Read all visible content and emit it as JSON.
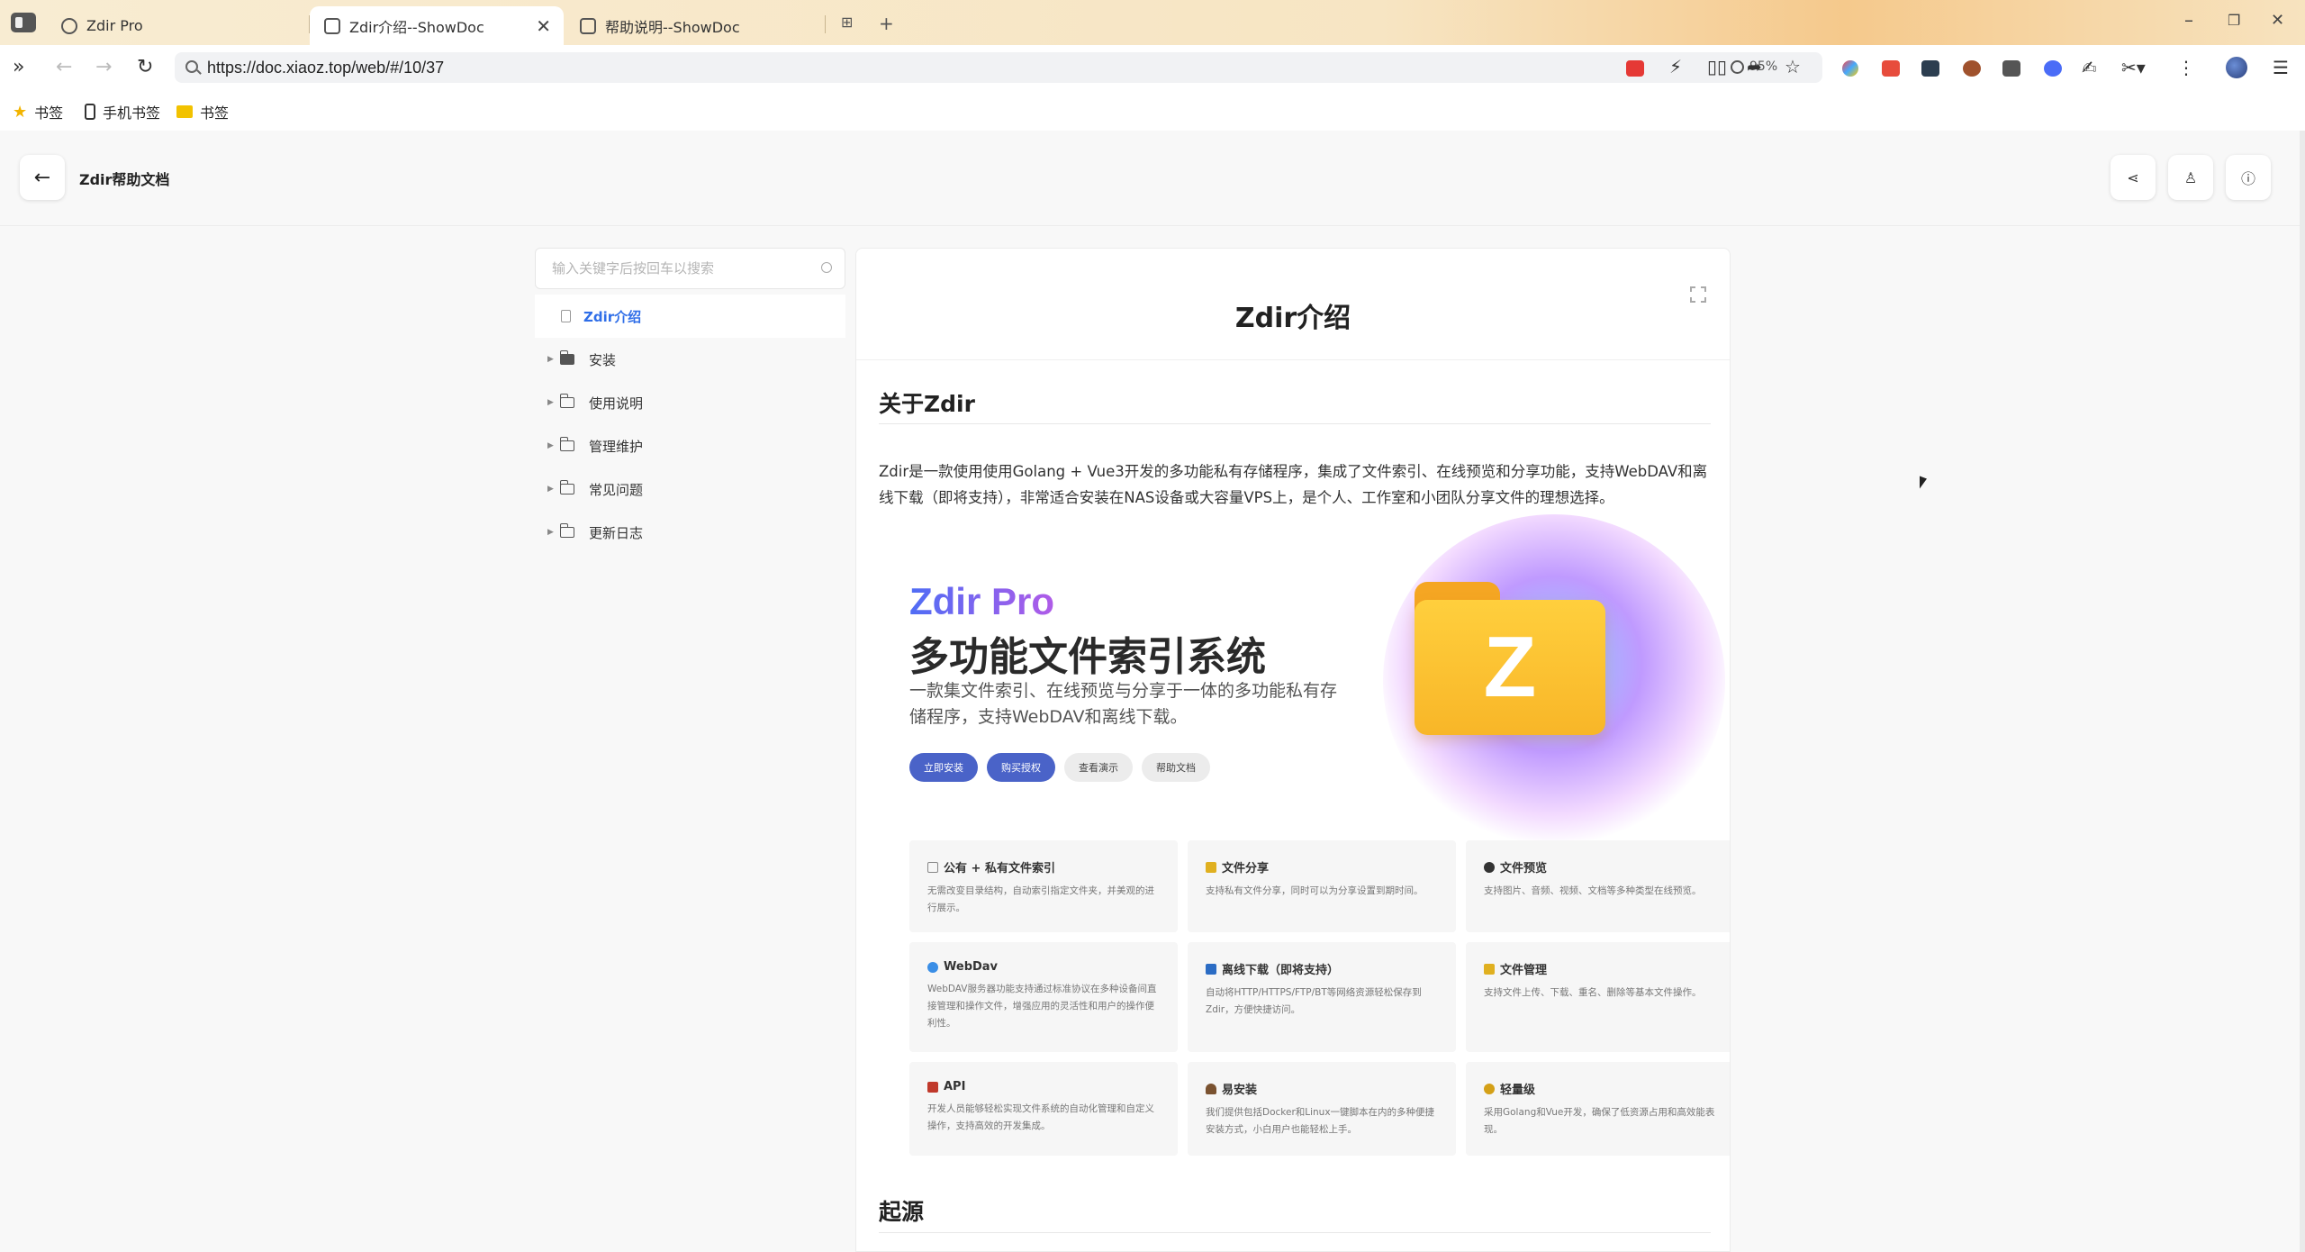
{
  "browser": {
    "tabs": [
      {
        "title": "Zdir Pro",
        "active": false
      },
      {
        "title": "Zdir介绍--ShowDoc",
        "active": true
      },
      {
        "title": "帮助说明--ShowDoc",
        "active": false
      }
    ],
    "url": "https://doc.xiaoz.top/web/#/10/37",
    "zoom": "95%",
    "bookmarks": [
      {
        "label": "书签",
        "icon": "star-icon"
      },
      {
        "label": "手机书签",
        "icon": "phone-icon"
      },
      {
        "label": "书签",
        "icon": "folder-icon"
      }
    ]
  },
  "header": {
    "title": "Zdir帮助文档"
  },
  "sidebar": {
    "search_placeholder": "输入关键字后按回车以搜索",
    "items": [
      {
        "label": "Zdir介绍",
        "type": "doc",
        "active": true
      },
      {
        "label": "安装",
        "type": "folder",
        "open": true
      },
      {
        "label": "使用说明",
        "type": "folder"
      },
      {
        "label": "管理维护",
        "type": "folder"
      },
      {
        "label": "常见问题",
        "type": "folder"
      },
      {
        "label": "更新日志",
        "type": "folder"
      }
    ]
  },
  "doc": {
    "title": "Zdir介绍",
    "section1_heading": "关于Zdir",
    "intro": "Zdir是一款使用使用Golang + Vue3开发的多功能私有存储程序，集成了文件索引、在线预览和分享功能，支持WebDAV和离线下载（即将支持），非常适合安装在NAS设备或大容量VPS上，是个人、工作室和小团队分享文件的理想选择。",
    "section2_heading": "起源"
  },
  "banner": {
    "brand": "Zdir Pro",
    "headline": "多功能文件索引系统",
    "subtitle": "一款集文件索引、在线预览与分享于一体的多功能私有存储程序，支持WebDAV和离线下载。",
    "buttons": [
      "立即安装",
      "购买授权",
      "查看演示",
      "帮助文档"
    ],
    "logo_letter": "Z",
    "features": [
      {
        "title": "公有 + 私有文件索引",
        "desc": "无需改变目录结构，自动索引指定文件夹，并美观的进行展示。",
        "icon_color": "#888888"
      },
      {
        "title": "文件分享",
        "desc": "支持私有文件分享，同时可以为分享设置到期时间。",
        "icon_color": "#e0b020"
      },
      {
        "title": "文件预览",
        "desc": "支持图片、音频、视频、文档等多种类型在线预览。",
        "icon_color": "#333333"
      },
      {
        "title": "WebDav",
        "desc": "WebDAV服务器功能支持通过标准协议在多种设备间直接管理和操作文件，增强应用的灵活性和用户的操作便利性。",
        "icon_color": "#3a8ee6"
      },
      {
        "title": "离线下载（即将支持）",
        "desc": "自动将HTTP/HTTPS/FTP/BT等网络资源轻松保存到Zdir，方便快捷访问。",
        "icon_color": "#2b6cc4"
      },
      {
        "title": "文件管理",
        "desc": "支持文件上传、下载、重名、删除等基本文件操作。",
        "icon_color": "#e0b020"
      },
      {
        "title": "API",
        "desc": "开发人员能够轻松实现文件系统的自动化管理和自定义操作，支持高效的开发集成。",
        "icon_color": "#c0392b"
      },
      {
        "title": "易安装",
        "desc": "我们提供包括Docker和Linux一键脚本在内的多种便捷安装方式，小白用户也能轻松上手。",
        "icon_color": "#7a5230"
      },
      {
        "title": "轻量级",
        "desc": "采用Golang和Vue开发，确保了低资源占用和高效能表现。",
        "icon_color": "#d4a017"
      }
    ]
  }
}
